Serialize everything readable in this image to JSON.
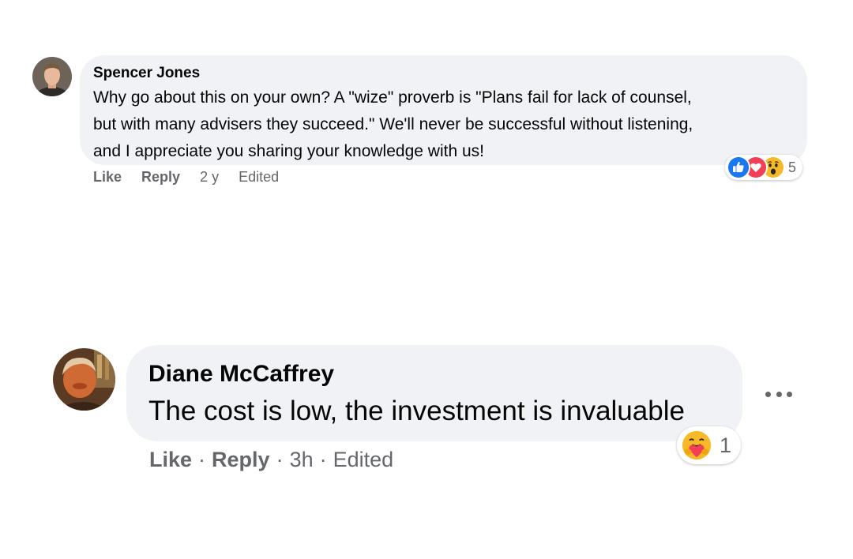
{
  "comments": [
    {
      "author": "Spencer Jones",
      "text_lines": [
        "Why go about this on your own? A \"wize\" proverb is \"Plans fail for lack of counsel,",
        "but with many advisers they succeed.\" We'll never be successful without listening,",
        "and I appreciate you sharing your knowledge with us!"
      ],
      "actions": {
        "like": "Like",
        "reply": "Reply",
        "time": "2 y",
        "edited": "Edited"
      },
      "reactions": {
        "icons": [
          "like-icon",
          "love-icon",
          "wow-icon"
        ],
        "count": "5"
      }
    },
    {
      "author": "Diane McCaffrey",
      "text_lines": [
        "The cost is low, the investment is invaluable"
      ],
      "actions": {
        "like": "Like",
        "reply": "Reply",
        "time": "3h",
        "edited": "Edited",
        "separator": "·"
      },
      "reactions": {
        "icons": [
          "care-icon"
        ],
        "count": "1"
      },
      "more_icon": "more-horizontal-icon"
    }
  ],
  "colors": {
    "bubble": "#f0f2f5",
    "secondary_text": "#65676b",
    "like_blue": "#1877f2",
    "love_red": "#f33e58",
    "emoji_yellow": "#f7b928"
  }
}
